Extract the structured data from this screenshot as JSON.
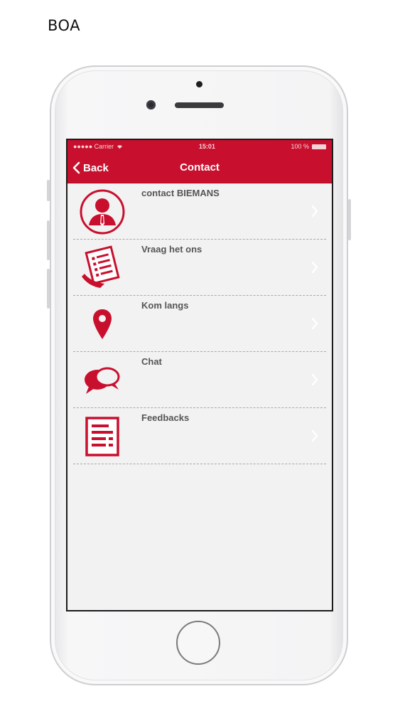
{
  "caption": "BOA",
  "status_bar": {
    "carrier": "●●●●● Carrier",
    "time": "15:01",
    "battery": "100 %"
  },
  "nav": {
    "back_label": "Back",
    "title": "Contact"
  },
  "items": [
    {
      "label": "contact BIEMANS",
      "icon": "person-icon"
    },
    {
      "label": "Vraag het ons",
      "icon": "document-icon"
    },
    {
      "label": "Kom langs",
      "icon": "map-pin-icon"
    },
    {
      "label": "Chat",
      "icon": "chat-bubbles-icon"
    },
    {
      "label": "Feedbacks",
      "icon": "form-icon"
    }
  ],
  "colors": {
    "brand_red": "#c8102e",
    "screen_bg": "#f2f2f2",
    "label_gray": "#555555",
    "chevron": "#ffffff"
  }
}
